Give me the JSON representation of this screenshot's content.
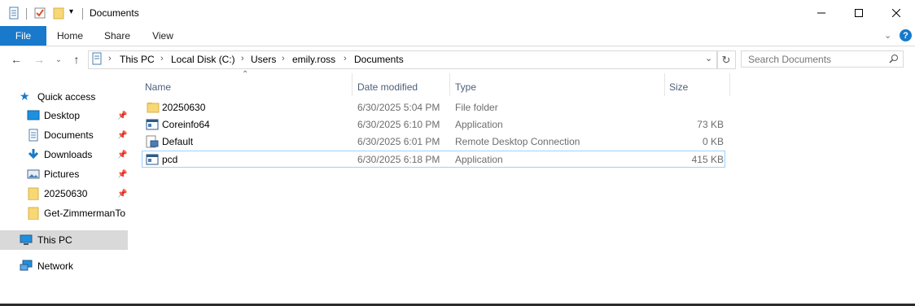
{
  "window": {
    "title": "Documents"
  },
  "ribbon": {
    "tabs": [
      {
        "label": "File"
      },
      {
        "label": "Home"
      },
      {
        "label": "Share"
      },
      {
        "label": "View"
      }
    ]
  },
  "address": {
    "breadcrumbs": [
      "This PC",
      "Local Disk (C:)",
      "Users",
      "emily.ross",
      "Documents"
    ]
  },
  "search": {
    "placeholder": "Search Documents"
  },
  "nav": {
    "quick_access": "Quick access",
    "items": [
      {
        "label": "Desktop",
        "icon": "desktop-icon",
        "pinned": true
      },
      {
        "label": "Documents",
        "icon": "documents-icon",
        "pinned": true
      },
      {
        "label": "Downloads",
        "icon": "downloads-icon",
        "pinned": true
      },
      {
        "label": "Pictures",
        "icon": "pictures-icon",
        "pinned": true
      },
      {
        "label": "20250630",
        "icon": "folder-icon",
        "pinned": true
      },
      {
        "label": "Get-ZimmermanTo",
        "icon": "folder-icon",
        "pinned": false
      }
    ],
    "this_pc": "This PC",
    "network": "Network"
  },
  "columns": {
    "name": "Name",
    "date": "Date modified",
    "type": "Type",
    "size": "Size"
  },
  "files": [
    {
      "name": "20250630",
      "date": "6/30/2025 5:04 PM",
      "type": "File folder",
      "size": "",
      "icon": "folder-icon"
    },
    {
      "name": "Coreinfo64",
      "date": "6/30/2025 6:10 PM",
      "type": "Application",
      "size": "73 KB",
      "icon": "application-icon"
    },
    {
      "name": "Default",
      "date": "6/30/2025 6:01 PM",
      "type": "Remote Desktop Connection",
      "size": "0 KB",
      "icon": "rdp-icon"
    },
    {
      "name": "pcd",
      "date": "6/30/2025 6:18 PM",
      "type": "Application",
      "size": "415 KB",
      "icon": "application-icon"
    }
  ],
  "colors": {
    "accent": "#1979ca",
    "folder": "#f8d775",
    "selection": "#d9d9d9",
    "focus_border": "#99d1ff",
    "header_text": "#4c607a"
  }
}
